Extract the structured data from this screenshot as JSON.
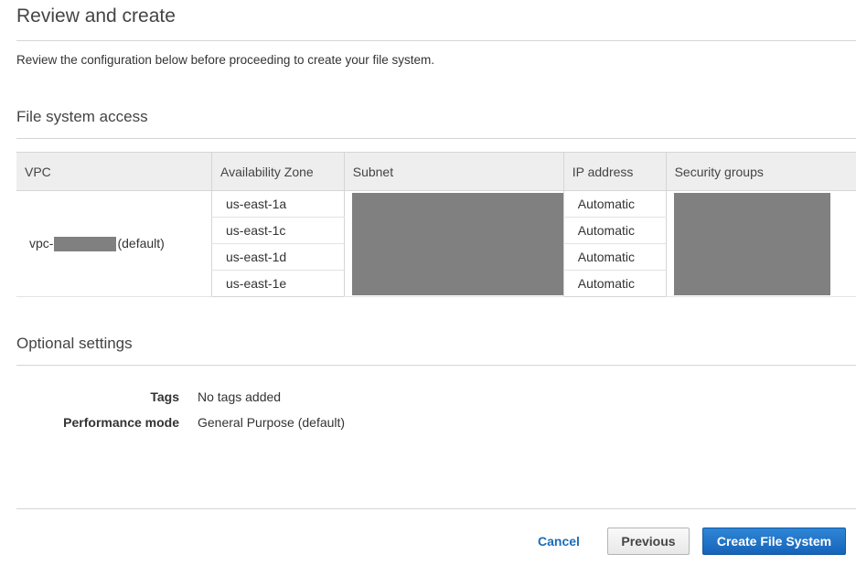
{
  "header": {
    "title": "Review and create",
    "description": "Review the configuration below before proceeding to create your file system."
  },
  "access": {
    "title": "File system access",
    "columns": [
      "VPC",
      "Availability Zone",
      "Subnet",
      "IP address",
      "Security groups"
    ],
    "vpc_prefix": "vpc-",
    "vpc_suffix": "(default)",
    "rows": [
      {
        "zone": "us-east-1a",
        "ip": "Automatic"
      },
      {
        "zone": "us-east-1c",
        "ip": "Automatic"
      },
      {
        "zone": "us-east-1d",
        "ip": "Automatic"
      },
      {
        "zone": "us-east-1e",
        "ip": "Automatic"
      }
    ]
  },
  "optional": {
    "title": "Optional settings",
    "tags_label": "Tags",
    "tags_value": "No tags added",
    "perf_label": "Performance mode",
    "perf_value": "General Purpose (default)"
  },
  "footer": {
    "cancel_label": "Cancel",
    "previous_label": "Previous",
    "create_label": "Create File System"
  },
  "colors": {
    "primary_button": "#1f72c7",
    "link": "#1a6db8",
    "redaction": "#808080"
  }
}
